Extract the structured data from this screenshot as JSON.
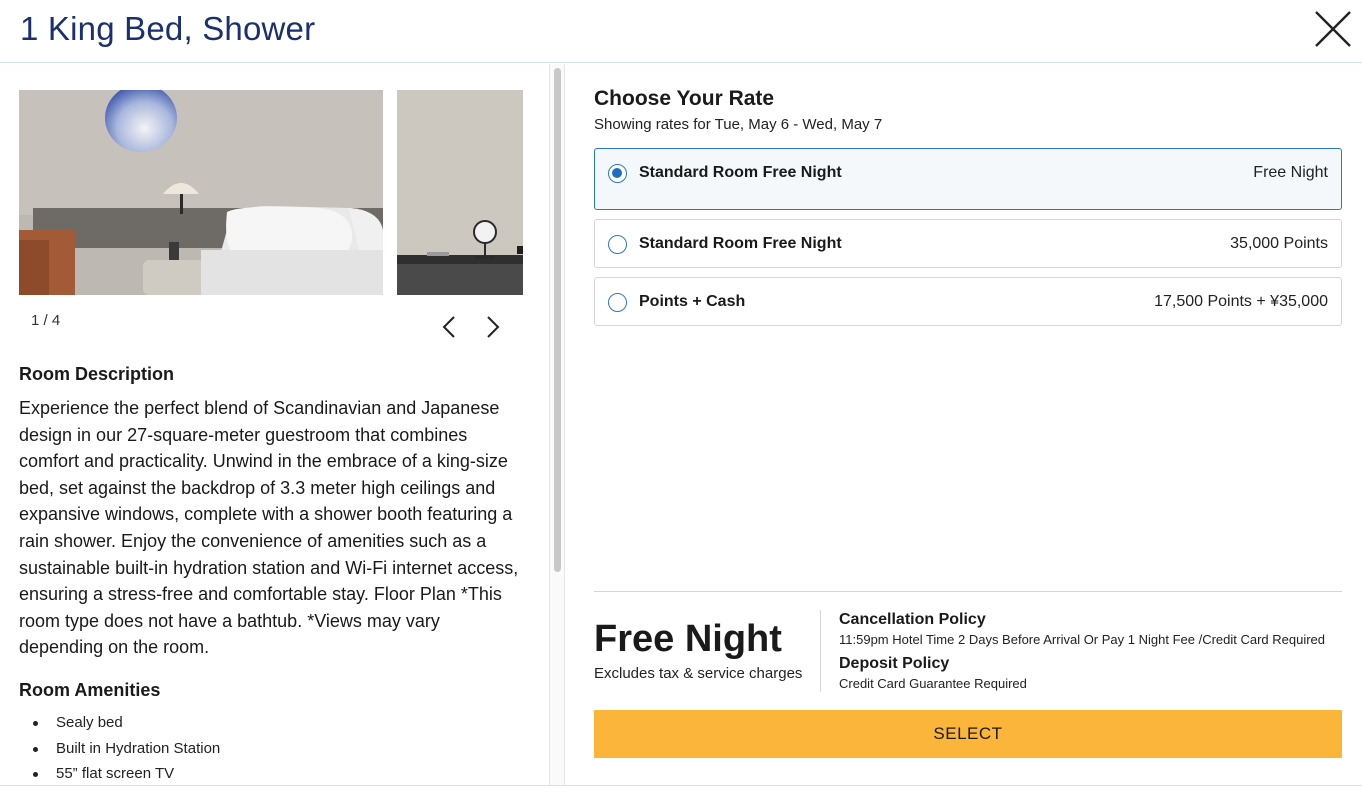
{
  "header": {
    "title": "1 King Bed, Shower"
  },
  "gallery": {
    "counter": "1 / 4"
  },
  "room": {
    "description_title": "Room Description",
    "description": "Experience the perfect blend of Scandinavian and Japanese design in our 27-square-meter guestroom that combines comfort and practicality. Unwind in the embrace of a king-size bed, set against the backdrop of 3.3 meter high ceilings and expansive windows, complete with a shower booth featuring a rain shower. Enjoy the convenience of amenities such as a sustainable built-in hydration station and Wi-Fi internet access, ensuring a stress-free and comfortable stay. Floor Plan *This room type does not have a bathtub. *Views may vary depending on the room.",
    "amenities_title": "Room Amenities",
    "amenities": [
      "Sealy bed",
      "Built in Hydration Station",
      "55” flat screen TV"
    ]
  },
  "rates": {
    "title": "Choose Your Rate",
    "subtitle": "Showing rates for Tue, May 6 - Wed, May 7",
    "options": [
      {
        "name": "Standard Room Free Night",
        "price": "Free Night",
        "selected": true
      },
      {
        "name": "Standard Room Free Night",
        "price": "35,000 Points",
        "selected": false
      },
      {
        "name": "Points + Cash",
        "price": "17,500 Points + ¥35,000",
        "selected": false
      }
    ]
  },
  "summary": {
    "price": "Free Night",
    "price_note": "Excludes tax & service charges",
    "cancellation_title": "Cancellation Policy",
    "cancellation_text": "11:59pm Hotel Time 2 Days Before Arrival Or Pay 1 Night Fee /Credit Card Required",
    "deposit_title": "Deposit Policy",
    "deposit_text": "Credit Card Guarantee Required",
    "select_label": "SELECT"
  },
  "colors": {
    "title_navy": "#1c2f6e",
    "selected_border": "#2b78c5",
    "select_button": "#fbb53a"
  },
  "icons": {
    "close": "close-icon",
    "prev": "chevron-left-icon",
    "next": "chevron-right-icon"
  }
}
